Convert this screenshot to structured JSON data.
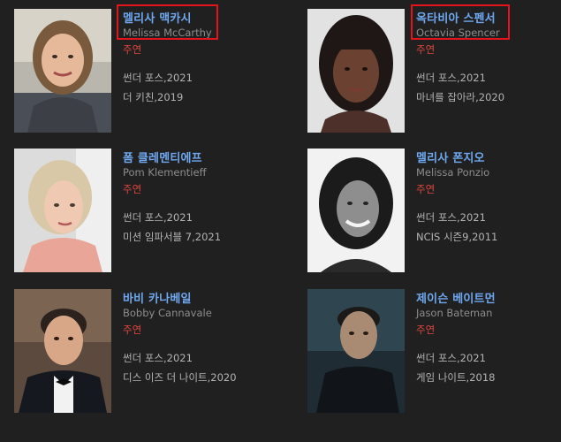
{
  "cast": [
    {
      "name_ko": "멜리사 맥카시",
      "name_en": "Melissa McCarthy",
      "role": "주연",
      "works": [
        "썬더 포스,2021",
        "더 키친,2019"
      ],
      "highlighted": true
    },
    {
      "name_ko": "옥타비아 스펜서",
      "name_en": "Octavia Spencer",
      "role": "주연",
      "works": [
        "썬더 포스,2021",
        "마녀를 잡아라,2020"
      ],
      "highlighted": true
    },
    {
      "name_ko": "폼 클레멘티에프",
      "name_en": "Pom Klementieff",
      "role": "주연",
      "works": [
        "썬더 포스,2021",
        "미션 임파서블 7,2021"
      ],
      "highlighted": false
    },
    {
      "name_ko": "멜리사 폰지오",
      "name_en": "Melissa Ponzio",
      "role": "주연",
      "works": [
        "썬더 포스,2021",
        "NCIS 시즌9,2011"
      ],
      "highlighted": false
    },
    {
      "name_ko": "바비 카나베일",
      "name_en": "Bobby Cannavale",
      "role": "주연",
      "works": [
        "썬더 포스,2021",
        "디스 이즈 더 나이트,2020"
      ],
      "highlighted": false
    },
    {
      "name_ko": "제이슨 베이트먼",
      "name_en": "Jason Bateman",
      "role": "주연",
      "works": [
        "썬더 포스,2021",
        "게임 나이트,2018"
      ],
      "highlighted": false
    }
  ],
  "colors": {
    "background": "#202021",
    "name": "#6fa8f0",
    "role": "#e0463d",
    "highlight_box": "#e3141b"
  }
}
